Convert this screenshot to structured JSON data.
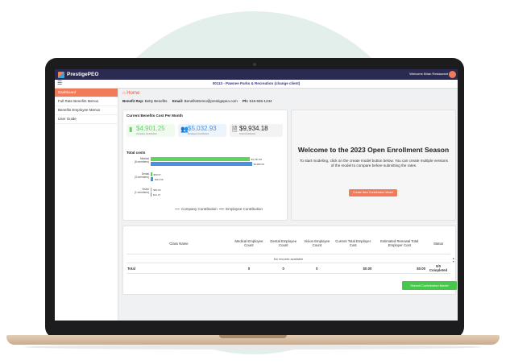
{
  "app": {
    "brand": "PrestigePEO",
    "welcome": "Welcome Brian Restaurant",
    "client": "00113 - Pawnee Parks & Recreation (change client)"
  },
  "sidebar": {
    "items": [
      {
        "label": "Dashboard",
        "active": true
      },
      {
        "label": "Full Rate Benefits Menus"
      },
      {
        "label": "Benefits Employee Menus"
      },
      {
        "label": "User Guide"
      }
    ]
  },
  "breadcrumb": {
    "home": "Home"
  },
  "rep": {
    "rep_label": "Benefit Rep:",
    "rep_name": "Betty Benefits",
    "email_label": "Email:",
    "email": "BenefitsDemo@prestigepeo.com",
    "ph_label": "Ph:",
    "phone": "516-555-1234"
  },
  "costs": {
    "title": "Current Benefits Cost Per Month",
    "company": {
      "value": "$4,901.25",
      "label": "Company Contribution"
    },
    "employee": {
      "value": "$5,032.93",
      "label": "Employee Contribution"
    },
    "total": {
      "value": "$9,934.18",
      "label": "Total Contribution"
    }
  },
  "chart_data": {
    "type": "bar",
    "title": "Total costs",
    "categories": [
      "Medical\n(8 members)",
      "Dental\n(3 members)",
      "Vision\n(1 members)"
    ],
    "series": [
      {
        "name": "Company Contribution",
        "color": "#5fd45f",
        "values": [
          4791.56,
          59.67,
          50.0
        ],
        "labels": [
          "$4,791.56",
          "$59.67",
          "$50.00"
        ]
      },
      {
        "name": "Employee Contribution",
        "color": "#4a90e2",
        "values": [
          4906.0,
          112.66,
          14.27
        ],
        "labels": [
          "$4,906.00",
          "$112.66",
          "$14.27"
        ]
      }
    ],
    "xlim": [
      0,
      5000
    ]
  },
  "enrollment": {
    "title": "Welcome to the 2023 Open Enrollment Season",
    "text": "To start modeling, click on the create model button below. You can create multiple versions of the model to compare before submitting the rates.",
    "button": "Create New Contribution Model"
  },
  "table": {
    "headers": [
      "Class Name",
      "Medical Employee Count",
      "Dental Employee Count",
      "Vision Employee Count",
      "Current Total Employer Cost",
      "Estimated Renewal Total Employer Cost",
      "Status"
    ],
    "empty": "No records available",
    "total": [
      "Total",
      "0",
      "0",
      "0",
      "$0.00",
      "$0.00",
      "0/0 Completed"
    ]
  },
  "submit_button": "Submit Contribution Model"
}
